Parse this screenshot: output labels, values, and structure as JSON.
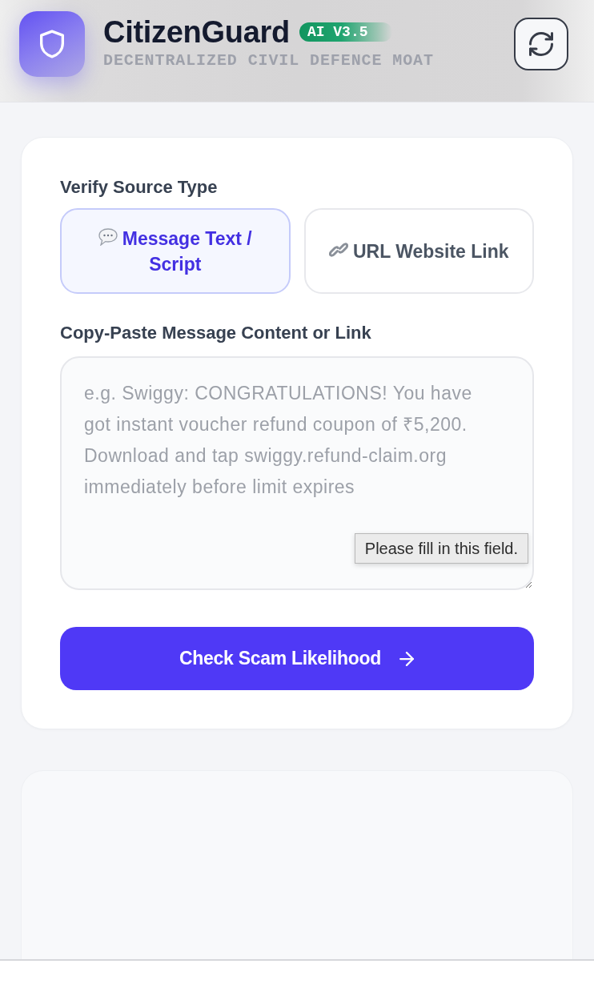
{
  "header": {
    "title": "CitizenGuard",
    "badge": "AI V3.5",
    "subtitle": "DECENTRALIZED CIVIL DEFENCE MOAT"
  },
  "source_section": {
    "label": "Verify Source Type",
    "types": [
      {
        "kind": "message",
        "label": "Message Text / Script",
        "selected": true
      },
      {
        "kind": "url",
        "label": "URL Website Link",
        "selected": false
      }
    ]
  },
  "content_section": {
    "label": "Copy-Paste Message Content or Link",
    "placeholder": "e.g. Swiggy: CONGRATULATIONS! You have got instant voucher refund coupon of ₹5,200. Download and tap swiggy.refund-claim.org immediately before limit expires",
    "validation_message": "Please fill in this field."
  },
  "submit_button": {
    "label": "Check Scam Likelihood"
  }
}
